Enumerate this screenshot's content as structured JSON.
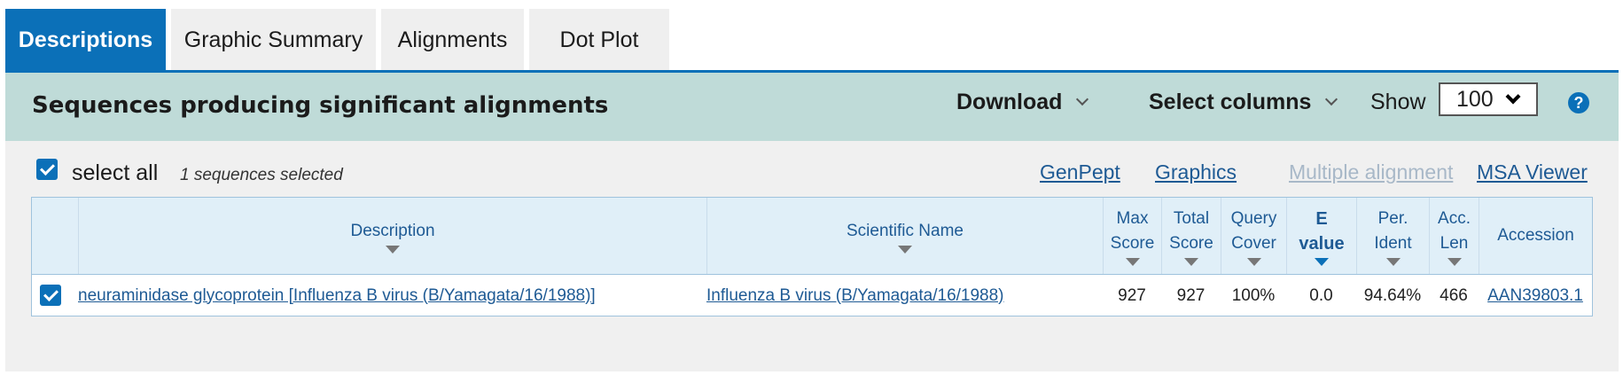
{
  "tabs": [
    {
      "label": "Descriptions",
      "active": true
    },
    {
      "label": "Graphic Summary",
      "active": false
    },
    {
      "label": "Alignments",
      "active": false
    },
    {
      "label": "Dot Plot",
      "active": false
    }
  ],
  "header": {
    "title": "Sequences producing significant alignments",
    "download_label": "Download",
    "select_columns_label": "Select columns",
    "show_label": "Show",
    "show_value": "100",
    "help_glyph": "?"
  },
  "toolbar": {
    "select_all_label": "select all",
    "selected_count": "1 sequences selected",
    "links": [
      "GenPept",
      "Graphics",
      "Multiple alignment",
      "MSA Viewer"
    ]
  },
  "table": {
    "columns": {
      "description": "Description",
      "scientific_name": "Scientific Name",
      "max_score": [
        "Max",
        "Score"
      ],
      "total_score": [
        "Total",
        "Score"
      ],
      "query_cover": [
        "Query",
        "Cover"
      ],
      "e_value": [
        "E",
        "value"
      ],
      "per_ident": [
        "Per.",
        "Ident"
      ],
      "acc_len": [
        "Acc.",
        "Len"
      ],
      "accession": "Accession"
    },
    "rows": [
      {
        "description": "neuraminidase glycoprotein [Influenza B virus (B/Yamagata/16/1988)]",
        "scientific_name": "Influenza B virus (B/Yamagata/16/1988)",
        "max_score": "927",
        "total_score": "927",
        "query_cover": "100%",
        "e_value": "0.0",
        "per_ident": "94.64%",
        "acc_len": "466",
        "accession": "AAN39803.1"
      }
    ]
  },
  "colors": {
    "accent": "#0b70b8",
    "header_bg": "#bfdbd8",
    "link": "#1e5a94",
    "link_disabled": "#a8b8c8"
  }
}
